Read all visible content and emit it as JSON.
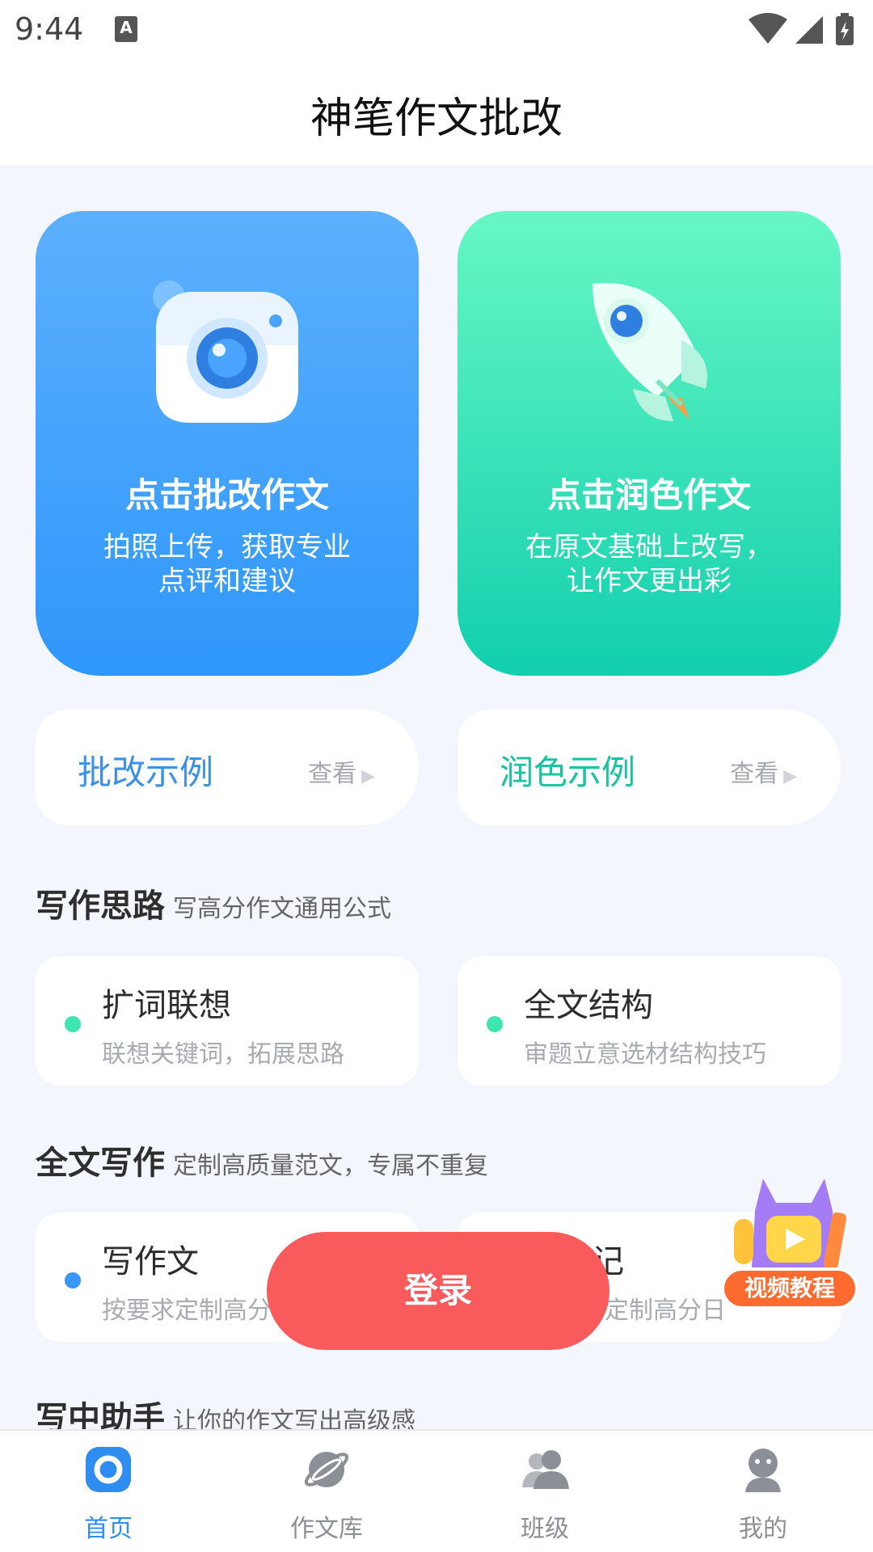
{
  "status_bar": {
    "time": "9:44",
    "notification_icon": "A"
  },
  "header": {
    "title": "神笔作文批改"
  },
  "cards": {
    "correct": {
      "title": "点击批改作文",
      "subtitle_line1": "拍照上传，获取专业",
      "subtitle_line2": "点评和建议",
      "icon": "camera-icon"
    },
    "polish": {
      "title": "点击润色作文",
      "subtitle_line1": "在原文基础上改写，",
      "subtitle_line2": "让作文更出彩",
      "icon": "rocket-icon"
    }
  },
  "examples": {
    "correct": {
      "label": "批改示例",
      "view": "查看"
    },
    "polish": {
      "label": "润色示例",
      "view": "查看"
    }
  },
  "sections": {
    "ideas": {
      "heading": "写作思路",
      "sub": "写高分作文通用公式",
      "items": [
        {
          "title": "扩词联想",
          "desc": "联想关键词，拓展思路"
        },
        {
          "title": "全文结构",
          "desc": "审题立意选材结构技巧"
        }
      ]
    },
    "full": {
      "heading": "全文写作",
      "sub": "定制高质量范文，专属不重复",
      "items": [
        {
          "title": "写作文",
          "desc": "按要求定制高分"
        },
        {
          "title": "记",
          "desc": "定制高分日"
        }
      ]
    },
    "assist": {
      "heading": "写中助手",
      "sub": "让你的作文写出高级感"
    }
  },
  "login_button": "登录",
  "video_badge": "视频教程",
  "bottom_nav": [
    {
      "label": "首页",
      "icon": "home-icon",
      "active": true
    },
    {
      "label": "作文库",
      "icon": "planet-icon",
      "active": false
    },
    {
      "label": "班级",
      "icon": "class-icon",
      "active": false
    },
    {
      "label": "我的",
      "icon": "profile-icon",
      "active": false
    }
  ],
  "colors": {
    "blue": "#2f97fb",
    "green": "#12cfae",
    "login": "#f95a5c",
    "nav_active": "#2f8cf0"
  }
}
